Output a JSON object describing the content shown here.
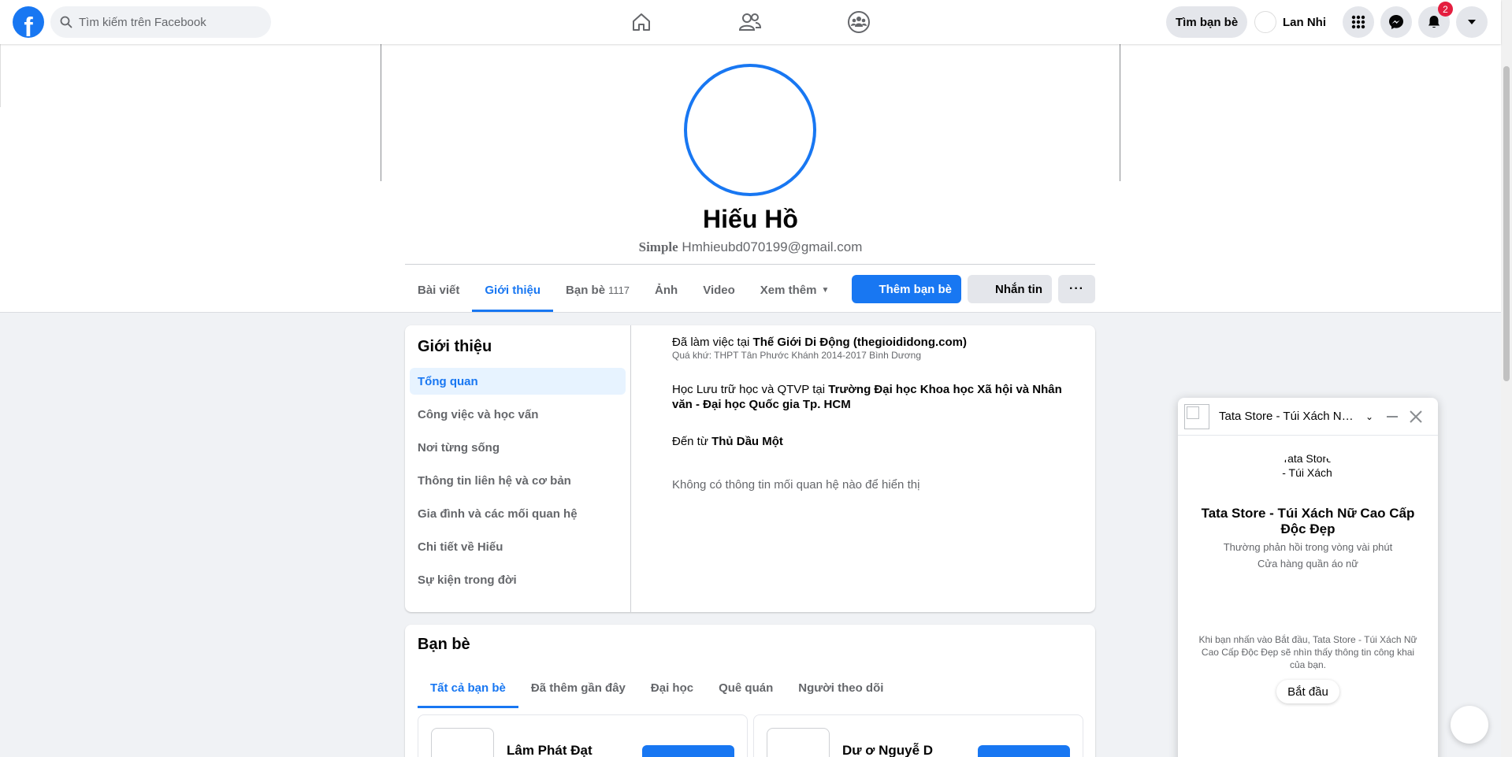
{
  "topbar": {
    "logo_letter": "f",
    "search_placeholder": "Tìm kiếm trên Facebook",
    "nav_icons": [
      "home-icon",
      "friends-icon",
      "groups-icon"
    ],
    "find_friends_label": "Tìm bạn bè",
    "user_name": "Lan Nhi",
    "notification_count": "2",
    "right_icons": [
      "menu-grid-icon",
      "messenger-icon",
      "bell-icon",
      "account-caret-icon"
    ]
  },
  "profile": {
    "name": "Hiếu Hồ",
    "subtitle_bold": "Simple",
    "subtitle_text": "Hmhieubd070199@gmail.com",
    "accent_color": "#1877f2"
  },
  "tabs": [
    {
      "label": "Bài viết",
      "count": ""
    },
    {
      "label": "Giới thiệu",
      "count": ""
    },
    {
      "label": "Bạn bè",
      "count": "1117"
    },
    {
      "label": "Ảnh",
      "count": ""
    },
    {
      "label": "Video",
      "count": ""
    },
    {
      "label": "Xem thêm",
      "count": ""
    }
  ],
  "actions": {
    "add_friend": "Thêm bạn bè",
    "message": "Nhắn tin",
    "more": "···"
  },
  "about": {
    "title": "Giới thiệu",
    "nav": [
      "Tổng quan",
      "Công việc và học vấn",
      "Nơi từng sống",
      "Thông tin liên hệ và cơ bản",
      "Gia đình và các mối quan hệ",
      "Chi tiết về Hiếu",
      "Sự kiện trong đời"
    ],
    "work_prefix": "Đã làm việc tại",
    "work_place": "Thế Giới Di Động (thegioididong.com)",
    "work_past": "Quá khứ: THPT Tân Phước Khánh 2014-2017 Bình Dương",
    "study_prefix": "Học Lưu trữ học và QTVP tại",
    "study_place": "Trường Đại học Khoa học Xã hội và Nhân văn - Đại học Quốc gia Tp. HCM",
    "from_prefix": "Đến từ",
    "from_place": "Thủ Dầu Một",
    "relationship_empty": "Không có thông tin mối quan hệ nào để hiển thị"
  },
  "friends": {
    "title": "Bạn bè",
    "tabs": [
      "Tất cả bạn bè",
      "Đã thêm gần đây",
      "Đại học",
      "Quê quán",
      "Người theo dõi"
    ],
    "tiles": [
      "Lâm Phát Đạt",
      "Dư ơ   Nguyễ  D"
    ]
  },
  "chat": {
    "title": "Tata Store - Túi Xách Nữ Cao Cấp Độc Đẹp",
    "logo_alt": "Tata Store - Túi Xách",
    "name": "Tata Store - Túi Xách Nữ Cao Cấp Độc Đẹp",
    "response": "Thường phản hồi trong vòng vài phút",
    "category": "Cửa hàng quần áo nữ",
    "note": "Khi bạn nhấn vào Bắt đầu, Tata Store - Túi Xách Nữ Cao Cấp Độc Đẹp sẽ nhìn thấy thông tin công khai của bạn.",
    "start": "Bắt đầu"
  }
}
